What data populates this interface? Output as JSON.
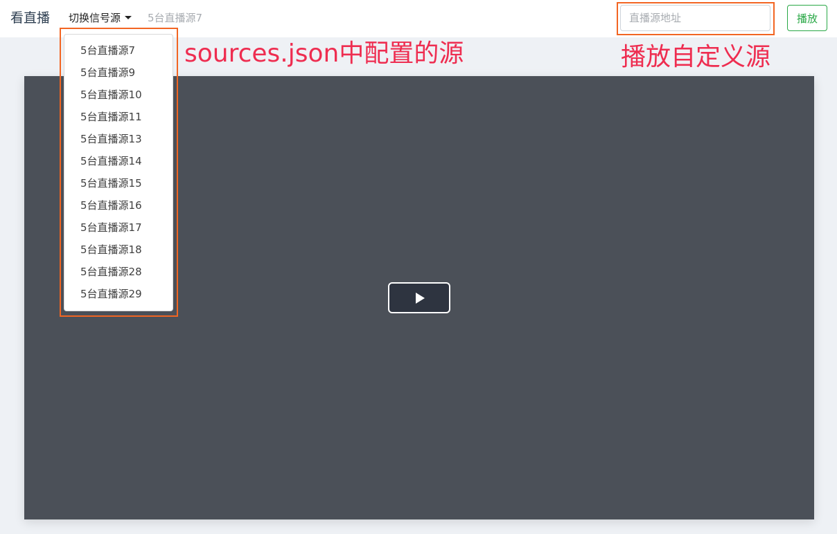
{
  "navbar": {
    "brand": "看直播",
    "source_toggle_label": "切换信号源",
    "current_source": "5台直播源7",
    "url_input_placeholder": "直播源地址",
    "play_button_label": "播放"
  },
  "source_menu": {
    "items": [
      "5台直播源7",
      "5台直播源9",
      "5台直播源10",
      "5台直播源11",
      "5台直播源13",
      "5台直播源14",
      "5台直播源15",
      "5台直播源16",
      "5台直播源17",
      "5台直播源18",
      "5台直播源28",
      "5台直播源29"
    ]
  },
  "annotations": {
    "menu_note": "sources.json中配置的源",
    "input_note": "播放自定义源",
    "accent_color": "#f26522",
    "text_color": "#ee2d50"
  },
  "player": {
    "play_icon": "play-icon"
  }
}
